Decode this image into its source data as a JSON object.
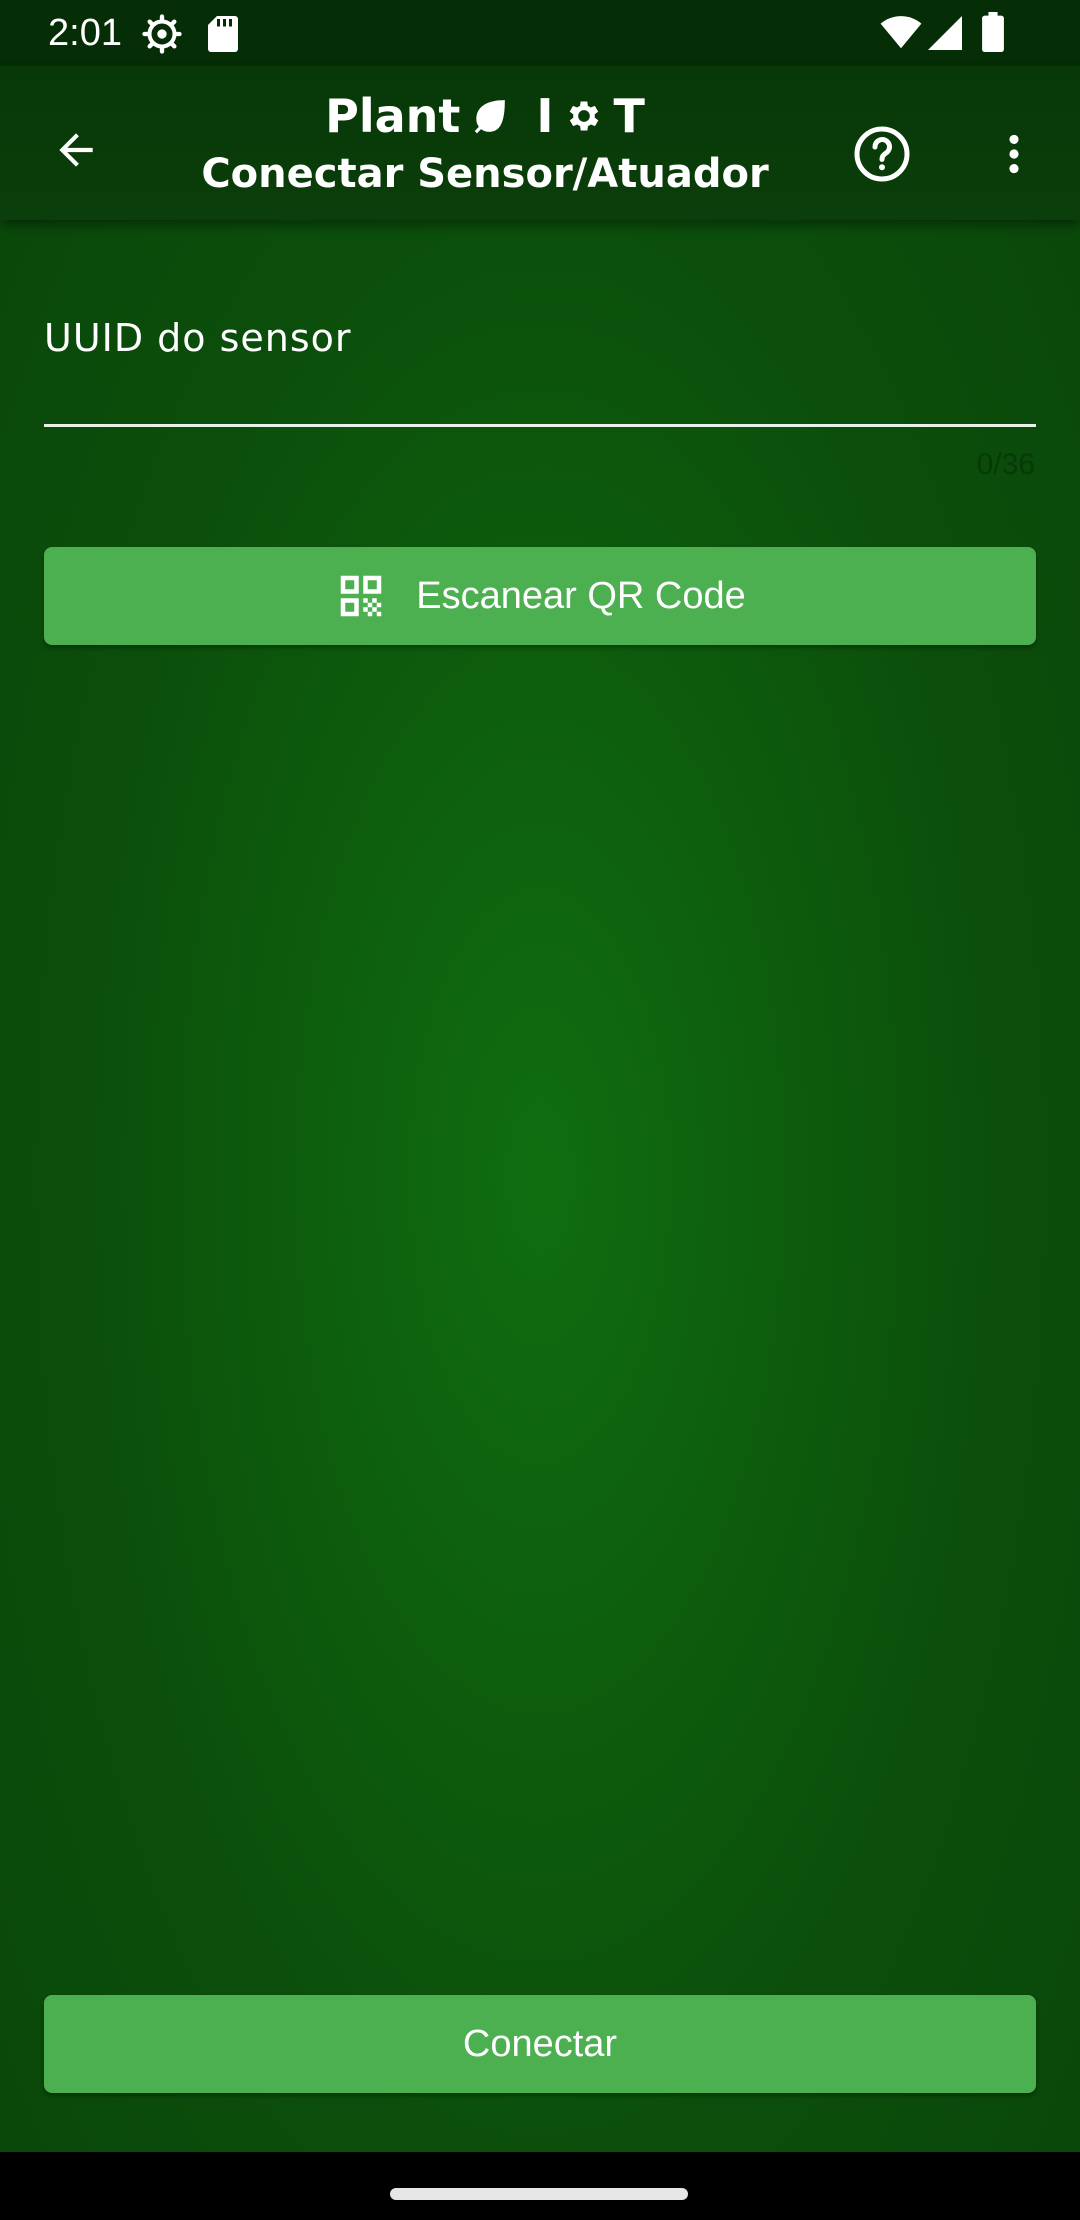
{
  "status_bar": {
    "time": "2:01",
    "icons": [
      "settings-gear-icon",
      "sd-card-icon",
      "wifi-icon",
      "signal-icon",
      "battery-icon"
    ]
  },
  "app_bar": {
    "title_prefix": "Plant",
    "title_suffix": "I",
    "title_end": "T",
    "subtitle": "Conectar Sensor/Atuador",
    "icons": [
      "back-arrow-icon",
      "leaf-icon",
      "gear-icon",
      "help-circle-icon",
      "more-vert-icon"
    ]
  },
  "form": {
    "uuid_label": "UUID do sensor",
    "uuid_value": "",
    "uuid_counter": "0/36"
  },
  "buttons": {
    "scan_label": "Escanear QR Code",
    "connect_label": "Conectar"
  },
  "colors": {
    "background": "#0d5e0d",
    "app_bar": "#083808",
    "button": "#4caf50",
    "text": "#ffffff"
  }
}
